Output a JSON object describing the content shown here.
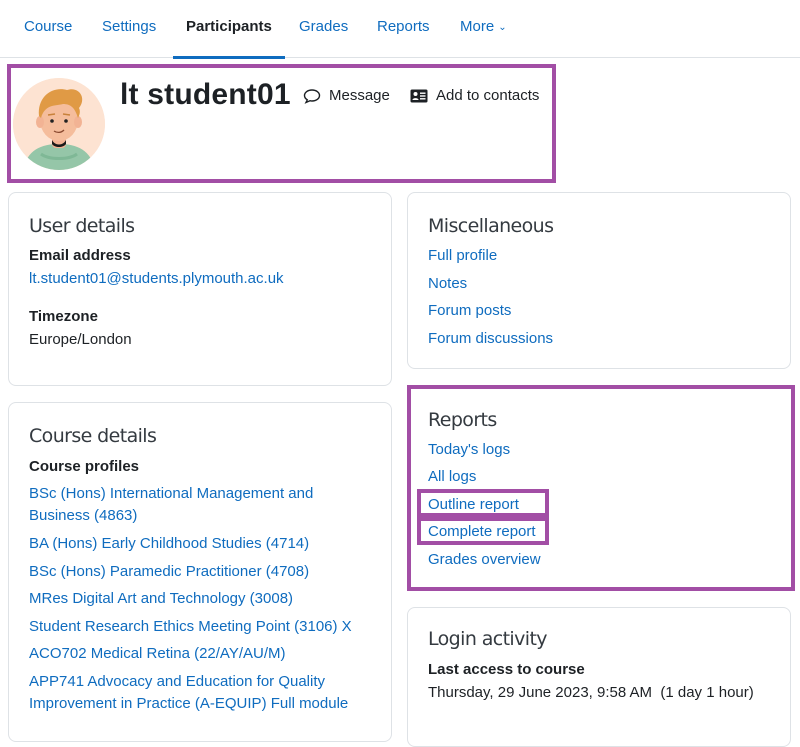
{
  "nav": {
    "items": [
      {
        "label": "Course"
      },
      {
        "label": "Settings"
      },
      {
        "label": "Participants",
        "active": true
      },
      {
        "label": "Grades"
      },
      {
        "label": "Reports"
      },
      {
        "label": "More"
      }
    ]
  },
  "header": {
    "user_name": "lt student01",
    "message_label": "Message",
    "add_contacts_label": "Add to contacts"
  },
  "user_details": {
    "title": "User details",
    "email_label": "Email address",
    "email_value": "lt.student01@students.plymouth.ac.uk",
    "timezone_label": "Timezone",
    "timezone_value": "Europe/London"
  },
  "course_details": {
    "title": "Course details",
    "profiles_label": "Course profiles",
    "courses": [
      "BSc (Hons) International Management and Business (4863)",
      "BA (Hons) Early Childhood Studies (4714)",
      "BSc (Hons) Paramedic Practitioner (4708)",
      "MRes Digital Art and Technology (3008)",
      "Student Research Ethics Meeting Point (3106) X",
      "ACO702 Medical Retina (22/AY/AU/M)",
      "APP741 Advocacy and Education for Quality Improvement in Practice (A-EQUIP) Full module"
    ]
  },
  "miscellaneous": {
    "title": "Miscellaneous",
    "links": [
      "Full profile",
      "Notes",
      "Forum posts",
      "Forum discussions"
    ]
  },
  "reports": {
    "title": "Reports",
    "links": [
      "Today's logs",
      "All logs",
      "Outline report",
      "Complete report",
      "Grades overview"
    ]
  },
  "login_activity": {
    "title": "Login activity",
    "last_access_label": "Last access to course",
    "last_access_value": "Thursday, 29 June 2023, 9:58 AM  (1 day 1 hour)"
  },
  "colors": {
    "link": "#0f6cbf",
    "highlight": "#a24ea5",
    "active_tab_underline": "#0f6cbf"
  }
}
